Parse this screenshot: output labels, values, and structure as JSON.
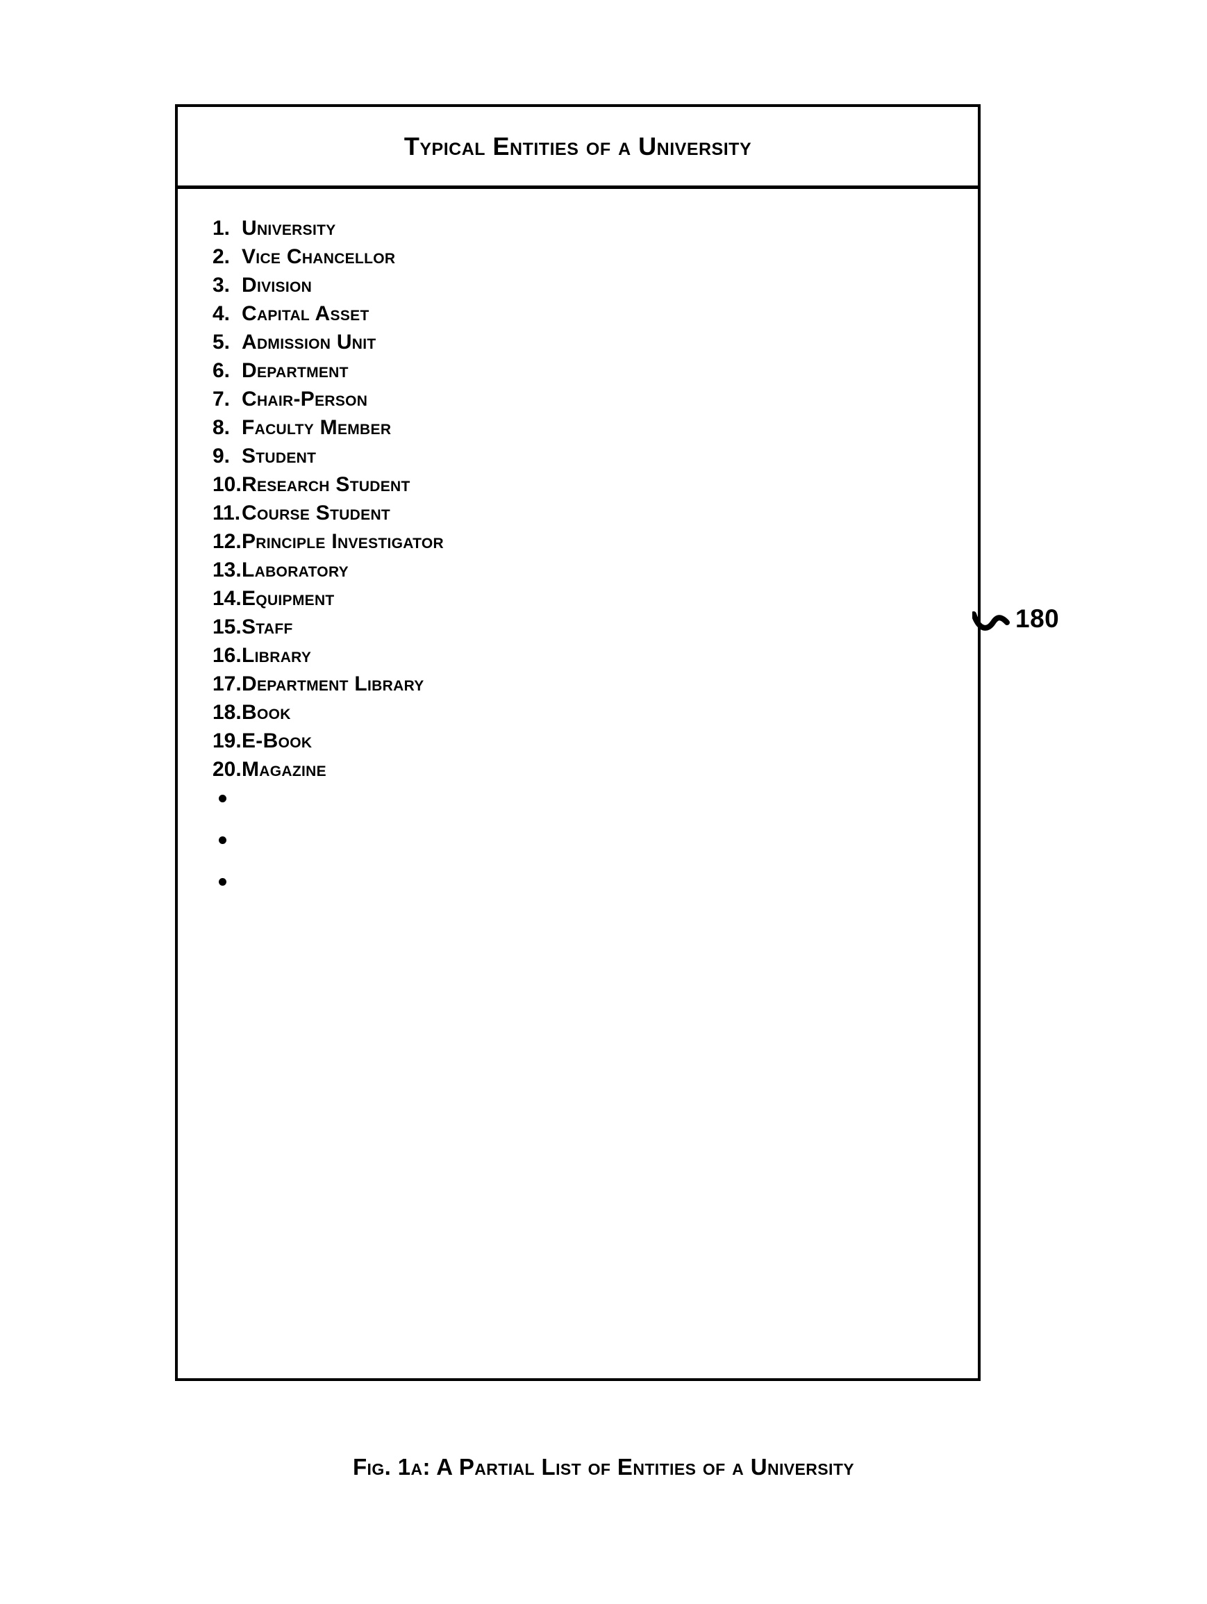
{
  "figure": {
    "box_title": "Typical Entities of a University",
    "reference_numeral": "180",
    "caption": "Fig. 1a: A Partial List of Entities of a University",
    "accent_color": "#000000",
    "background_color": "#ffffff"
  },
  "entities": [
    {
      "num": "1.",
      "label": "University"
    },
    {
      "num": "2.",
      "label": "Vice Chancellor"
    },
    {
      "num": "3.",
      "label": "Division"
    },
    {
      "num": "4.",
      "label": "Capital Asset"
    },
    {
      "num": "5.",
      "label": "Admission Unit"
    },
    {
      "num": "6.",
      "label": "Department"
    },
    {
      "num": "7.",
      "label": "Chair-Person"
    },
    {
      "num": "8.",
      "label": "Faculty Member"
    },
    {
      "num": "9.",
      "label": "Student"
    },
    {
      "num": "10.",
      "label": "Research Student"
    },
    {
      "num": "11.",
      "label": "Course Student"
    },
    {
      "num": "12.",
      "label": "Principle Investigator"
    },
    {
      "num": "13.",
      "label": "Laboratory"
    },
    {
      "num": "14.",
      "label": "Equipment"
    },
    {
      "num": "15.",
      "label": "Staff"
    },
    {
      "num": "16.",
      "label": "Library"
    },
    {
      "num": "17.",
      "label": "Department Library"
    },
    {
      "num": "18.",
      "label": "Book"
    },
    {
      "num": "19.",
      "label": "E-Book"
    },
    {
      "num": "20.",
      "label": "Magazine"
    }
  ],
  "continuation": {
    "dot_count": 3,
    "meaning": "vertical-ellipsis-list-continues"
  }
}
